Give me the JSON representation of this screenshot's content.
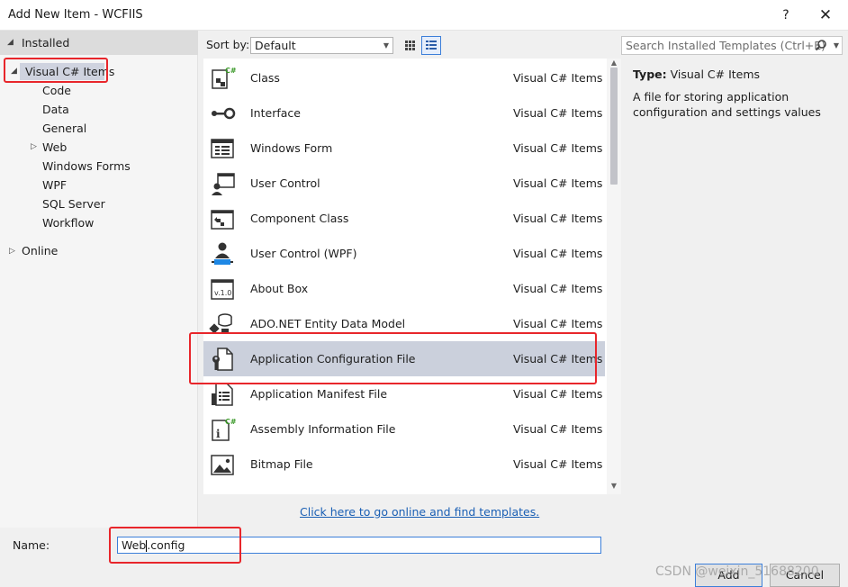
{
  "window": {
    "title": "Add New Item - WCFIIS",
    "help": "?",
    "close": "✕"
  },
  "tree": {
    "installed": "Installed",
    "visual_cs": "Visual C# Items",
    "children": [
      "Code",
      "Data",
      "General",
      "Web",
      "Windows Forms",
      "WPF",
      "SQL Server",
      "Workflow"
    ],
    "online": "Online"
  },
  "sort": {
    "label": "Sort by:",
    "value": "Default"
  },
  "search": {
    "placeholder": "Search Installed Templates (Ctrl+E)"
  },
  "items": [
    {
      "name": "Class",
      "category": "Visual C# Items",
      "icon": "class-icon"
    },
    {
      "name": "Interface",
      "category": "Visual C# Items",
      "icon": "interface-icon"
    },
    {
      "name": "Windows Form",
      "category": "Visual C# Items",
      "icon": "windows-form-icon"
    },
    {
      "name": "User Control",
      "category": "Visual C# Items",
      "icon": "user-control-icon"
    },
    {
      "name": "Component Class",
      "category": "Visual C# Items",
      "icon": "component-class-icon"
    },
    {
      "name": "User Control (WPF)",
      "category": "Visual C# Items",
      "icon": "user-control-wpf-icon"
    },
    {
      "name": "About Box",
      "category": "Visual C# Items",
      "icon": "about-box-icon"
    },
    {
      "name": "ADO.NET Entity Data Model",
      "category": "Visual C# Items",
      "icon": "entity-data-model-icon"
    },
    {
      "name": "Application Configuration File",
      "category": "Visual C# Items",
      "icon": "config-file-icon"
    },
    {
      "name": "Application Manifest File",
      "category": "Visual C# Items",
      "icon": "manifest-file-icon"
    },
    {
      "name": "Assembly Information File",
      "category": "Visual C# Items",
      "icon": "assembly-info-icon"
    },
    {
      "name": "Bitmap File",
      "category": "Visual C# Items",
      "icon": "bitmap-file-icon"
    }
  ],
  "online_link": "Click here to go online and find templates.",
  "details": {
    "type_label": "Type:",
    "type_value": "Visual C# Items",
    "description": "A file for storing application configuration and settings values"
  },
  "name_field": {
    "label": "Name:",
    "value_before": "Web",
    "value_after": ".config"
  },
  "buttons": {
    "add": "Add",
    "cancel": "Cancel"
  },
  "watermark": "CSDN @weixin_51688200",
  "colors": {
    "highlight": "#e8262b",
    "selection": "#cbd0dc",
    "link": "#1a5fb4"
  }
}
